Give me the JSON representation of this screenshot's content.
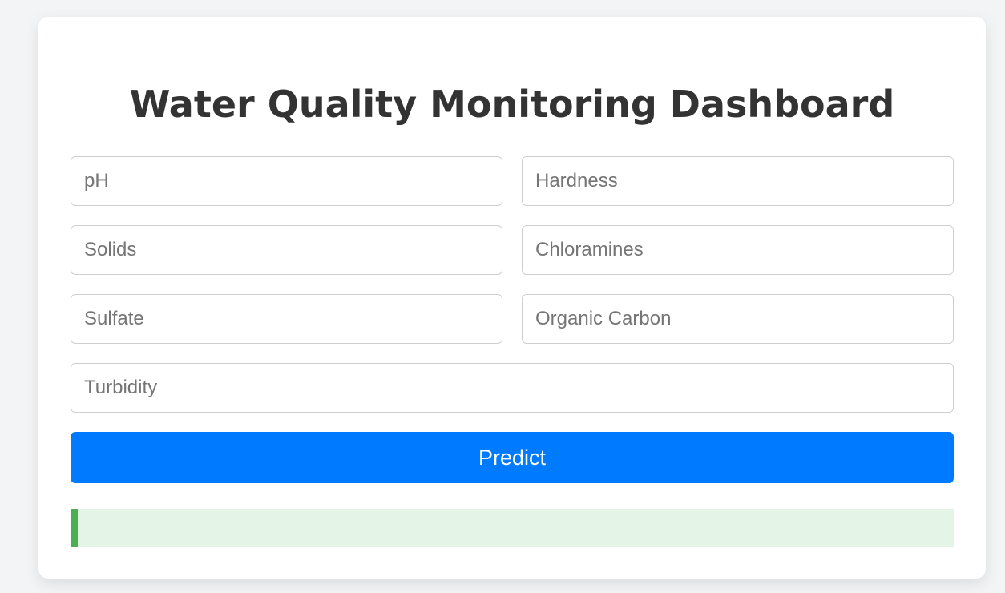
{
  "header": {
    "title": "Water Quality Monitoring Dashboard"
  },
  "form": {
    "fields": {
      "ph": {
        "placeholder": "pH",
        "value": ""
      },
      "hardness": {
        "placeholder": "Hardness",
        "value": ""
      },
      "solids": {
        "placeholder": "Solids",
        "value": ""
      },
      "chloramines": {
        "placeholder": "Chloramines",
        "value": ""
      },
      "sulfate": {
        "placeholder": "Sulfate",
        "value": ""
      },
      "organic_carbon": {
        "placeholder": "Organic Carbon",
        "value": ""
      },
      "turbidity": {
        "placeholder": "Turbidity",
        "value": ""
      }
    },
    "predict_label": "Predict"
  },
  "result": {
    "text": "",
    "accent_color": "#4caf50",
    "background_color": "#e4f4e6"
  },
  "colors": {
    "primary": "#007bff",
    "title": "#333333",
    "page_background": "#f3f4f6"
  }
}
